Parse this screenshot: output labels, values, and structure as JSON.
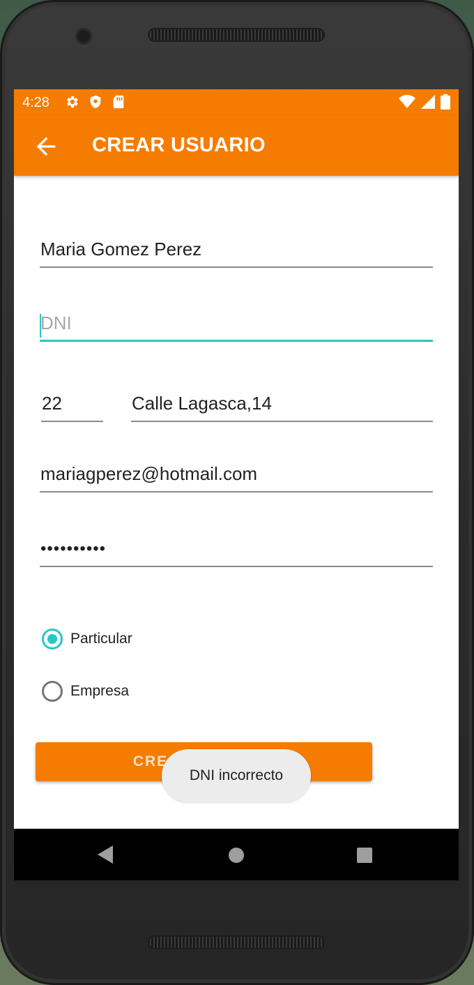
{
  "status_bar": {
    "time": "4:28",
    "icons": [
      "gear-icon",
      "shield-icon",
      "sd-card-icon"
    ],
    "right_icons": [
      "wifi-icon",
      "signal-icon",
      "battery-icon"
    ]
  },
  "app_bar": {
    "title": "CREAR USUARIO",
    "back_icon": "arrow-left-icon"
  },
  "form": {
    "name_value": "Maria Gomez Perez",
    "dni_placeholder": "DNI",
    "dni_value": "",
    "number_value": "22",
    "address_value": "Calle Lagasca,14",
    "email_value": "mariagperez@hotmail.com",
    "password_value": "••••••••••"
  },
  "radio_group": {
    "options": [
      {
        "label": "Particular",
        "selected": true
      },
      {
        "label": "Empresa",
        "selected": false
      }
    ]
  },
  "create_button": {
    "label": "CREAR USUARIO"
  },
  "toast": {
    "text": "DNI incorrecto"
  },
  "colors": {
    "primary": "#f57c00",
    "accent": "#26c6c6",
    "background": "#ffffff"
  }
}
